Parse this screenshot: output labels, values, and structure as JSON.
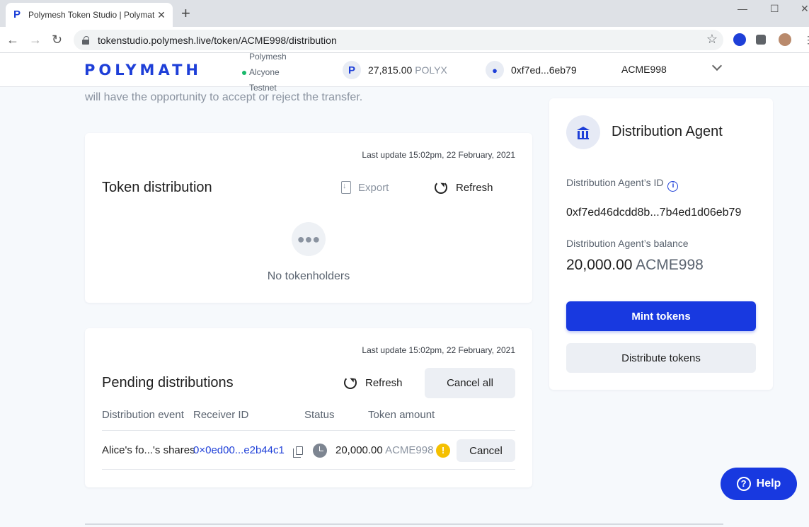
{
  "browser": {
    "tab_title": "Polymesh Token Studio | Polymat",
    "url": "tokenstudio.polymesh.live/token/ACME998/distribution"
  },
  "header": {
    "logo": "POLYMATH",
    "network_line1": "Polymesh",
    "network_line2": "Alcyone",
    "network_line3": "Testnet",
    "balance_amount": "27,815.00",
    "balance_unit": "POLYX",
    "account": "0xf7ed...6eb79",
    "token_selector": "ACME998"
  },
  "intro_text": "will have the opportunity to accept or reject the transfer.",
  "token_distribution": {
    "last_update": "Last update 15:02pm, 22 February, 2021",
    "title": "Token distribution",
    "export_label": "Export",
    "refresh_label": "Refresh",
    "empty_text": "No tokenholders"
  },
  "pending": {
    "last_update": "Last update 15:02pm, 22 February, 2021",
    "title": "Pending distributions",
    "refresh_label": "Refresh",
    "cancel_all_label": "Cancel all",
    "columns": [
      "Distribution event",
      "Receiver ID",
      "Status",
      "Token amount"
    ],
    "rows": [
      {
        "event": "Alice's fo...'s shares",
        "receiver": "0×0ed00...e2b44c1",
        "amount": "20,000.00",
        "unit": "ACME998",
        "cancel_label": "Cancel"
      }
    ]
  },
  "agent": {
    "title": "Distribution Agent",
    "id_label": "Distribution Agent’s ID",
    "id_value": "0xf7ed46dcdd8b...7b4ed1d06eb79",
    "balance_label": "Distribution Agent’s balance",
    "balance_amount": "20,000.00",
    "balance_unit": "ACME998",
    "mint_label": "Mint tokens",
    "distribute_label": "Distribute tokens"
  },
  "help_label": "Help",
  "colors": {
    "brand": "#1839e0",
    "warning": "#f5c000",
    "online": "#19b86b"
  }
}
